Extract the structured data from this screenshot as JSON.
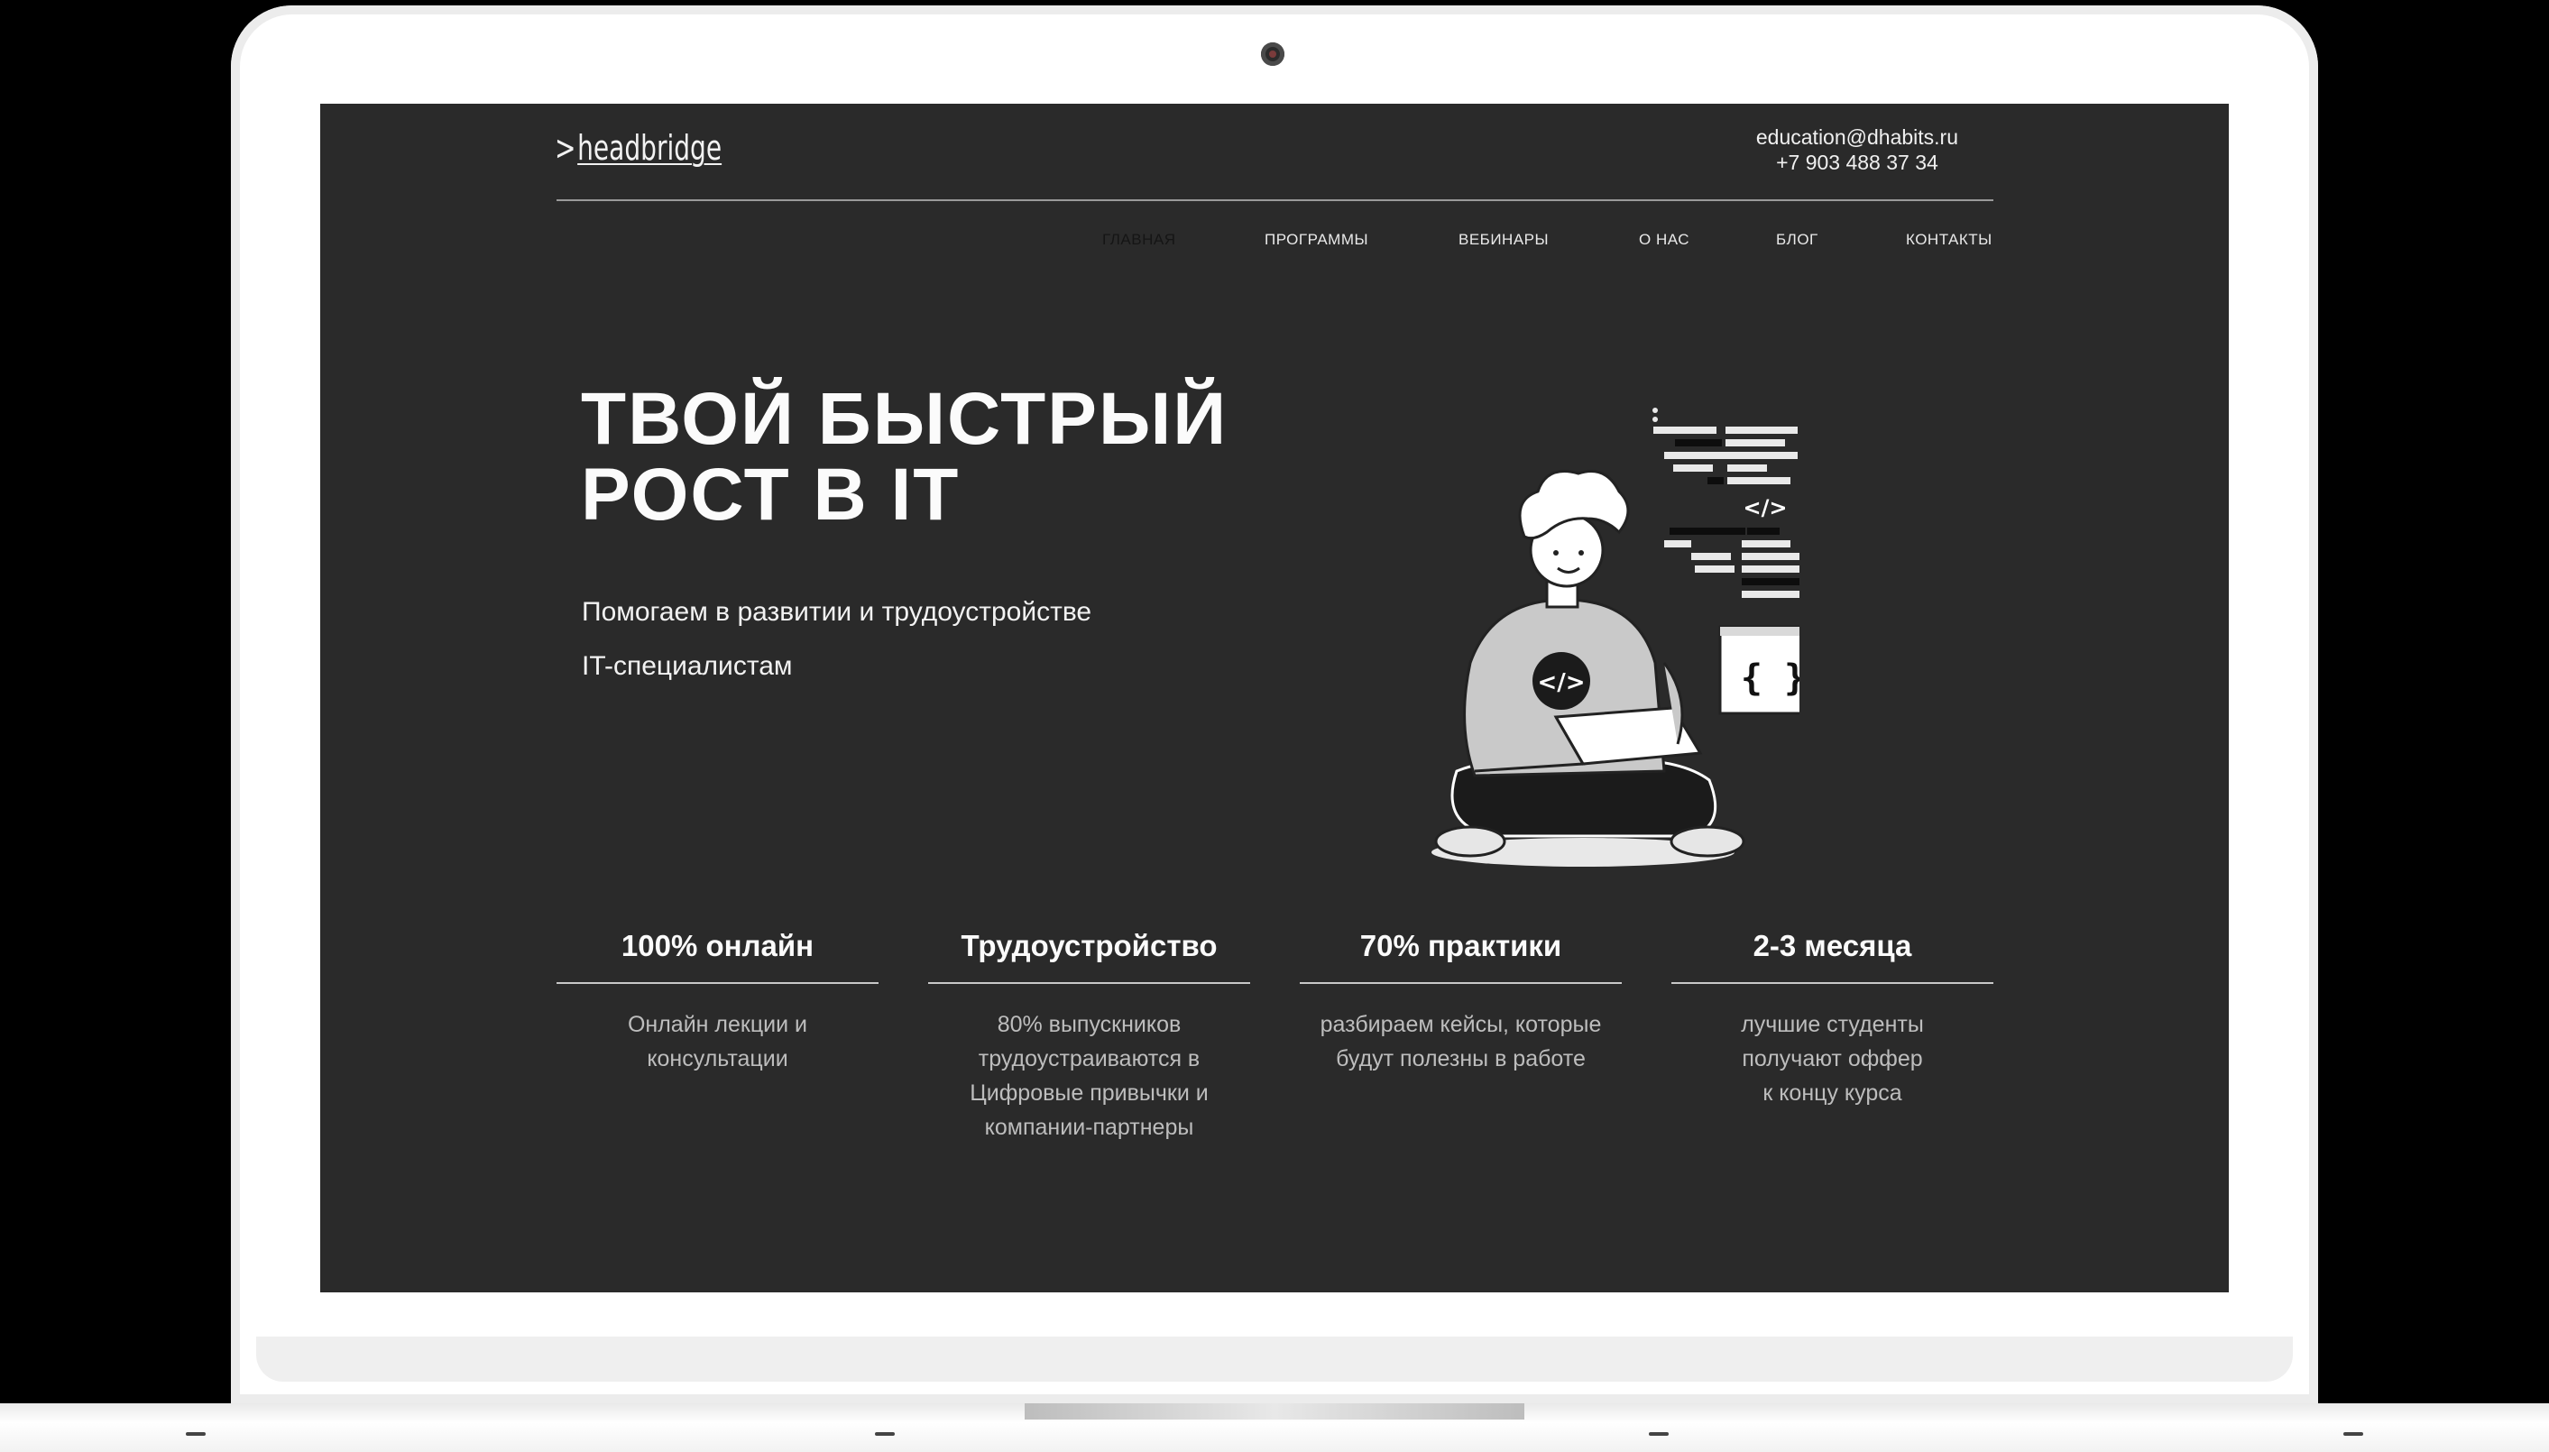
{
  "site": {
    "logo_text": "headbridge",
    "logo_prefix": ">",
    "contact_email": "education@dhabits.ru",
    "contact_phone": "+7 903 488 37 34"
  },
  "nav": {
    "items": [
      {
        "label": "ГЛАВНАЯ",
        "active": true
      },
      {
        "label": "ПРОГРАММЫ",
        "active": false
      },
      {
        "label": "ВЕБИНАРЫ",
        "active": false
      },
      {
        "label": "О НАС",
        "active": false
      },
      {
        "label": "БЛОГ",
        "active": false
      },
      {
        "label": "КОНТАКТЫ",
        "active": false
      }
    ]
  },
  "hero": {
    "title_line1": "ТВОЙ БЫСТРЫЙ",
    "title_line2": "РОСТ В IT",
    "subtitle_line1": "Помогаем в развитии и трудоустройстве",
    "subtitle_line2": "IT-специалистам",
    "illustration_icon": "developer-with-laptop-illustration",
    "code_tag": "</>",
    "braces": "{ }"
  },
  "features": [
    {
      "title": "100% онлайн",
      "desc": [
        "Онлайн лекции и",
        "консультации"
      ]
    },
    {
      "title": "Трудоустройство",
      "desc": [
        "80% выпускников",
        "трудоустраиваются в",
        "Цифровые привычки и",
        "компании-партнеры"
      ]
    },
    {
      "title": "70% практики",
      "desc": [
        "разбираем кейсы, которые",
        "будут полезны в работе"
      ]
    },
    {
      "title": "2-3 месяца",
      "desc": [
        "лучшие студенты",
        "получают оффер",
        "к концу курса"
      ]
    }
  ],
  "colors": {
    "screen_bg": "#2a2a2a",
    "text_primary": "#fbfbfb",
    "text_secondary": "#bdbdbd",
    "nav_active": "#151515"
  }
}
